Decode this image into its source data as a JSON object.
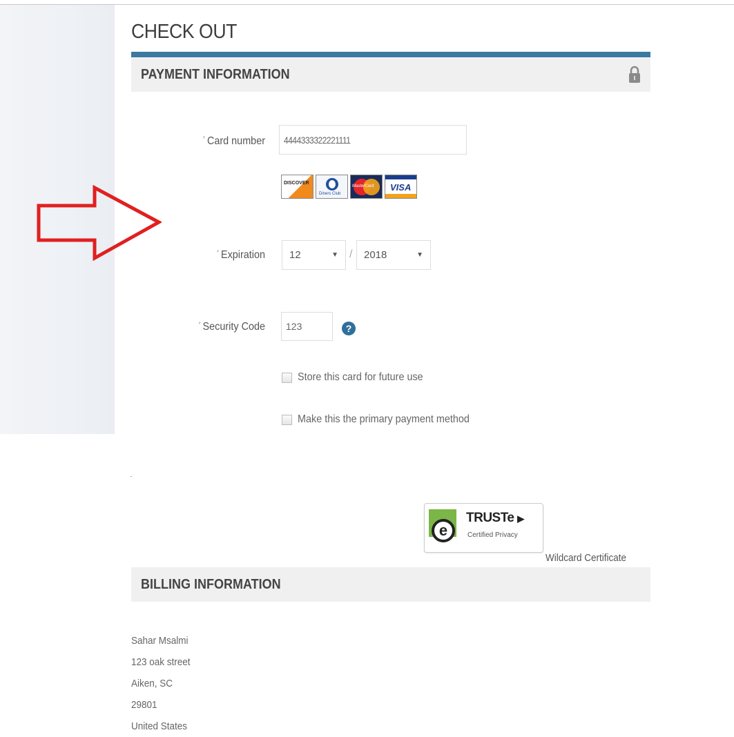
{
  "page": {
    "title": "CHECK OUT"
  },
  "payment": {
    "header": "PAYMENT INFORMATION",
    "card_number_label": "Card number",
    "card_number_value": "4444333322221111",
    "card_brands": [
      "DISCOVER",
      "Diners Club",
      "MasterCard",
      "VISA"
    ],
    "expiration_label": "Expiration",
    "exp_month": "12",
    "exp_year": "2018",
    "separator": "/",
    "security_code_label": "Security Code",
    "security_code_value": "123",
    "help_symbol": "?",
    "store_card_label": "Store this card for future use",
    "primary_method_label": "Make this the primary payment method",
    "required_marker": "*"
  },
  "trust": {
    "brand": "TRUSTe",
    "subtitle": "Certified Privacy",
    "certificate": "Wildcard Certificate"
  },
  "billing": {
    "header": "BILLING INFORMATION",
    "address_lines": [
      "Sahar Msalmi",
      "123 oak street",
      "Aiken, SC",
      "29801",
      "United States"
    ]
  },
  "colors": {
    "accent": "#3a79a0",
    "arrow": "#e02020",
    "truste_green": "#7ab648"
  }
}
